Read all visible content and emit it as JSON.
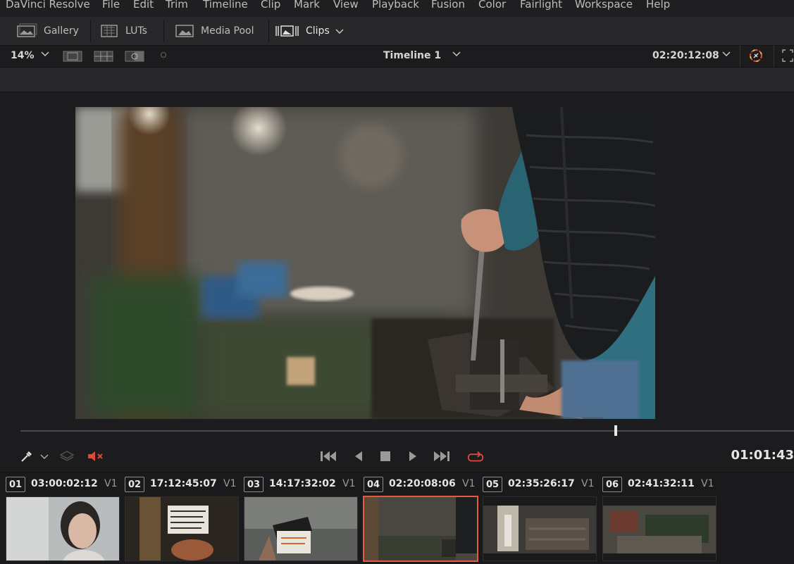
{
  "menu": {
    "app": "DaVinci Resolve",
    "items": [
      "File",
      "Edit",
      "Trim",
      "Timeline",
      "Clip",
      "Mark",
      "View",
      "Playback",
      "Fusion",
      "Color",
      "Fairlight",
      "Workspace",
      "Help"
    ]
  },
  "toolbar": {
    "gallery": "Gallery",
    "luts": "LUTs",
    "media_pool": "Media Pool",
    "clips": "Clips"
  },
  "viewer": {
    "zoom": "14%",
    "timeline_name": "Timeline 1",
    "timecode": "02:20:12:08"
  },
  "scrubber": {
    "playhead_position": 0.77
  },
  "transport": {
    "timecode": "01:01:43"
  },
  "clips": [
    {
      "num": "01",
      "tc": "03:00:02:12",
      "track": "V1"
    },
    {
      "num": "02",
      "tc": "17:12:45:07",
      "track": "V1"
    },
    {
      "num": "03",
      "tc": "14:17:32:02",
      "track": "V1"
    },
    {
      "num": "04",
      "tc": "02:20:08:06",
      "track": "V1"
    },
    {
      "num": "05",
      "tc": "02:35:26:17",
      "track": "V1"
    },
    {
      "num": "06",
      "tc": "02:41:32:11",
      "track": "V1"
    }
  ],
  "colors": {
    "accent": "#e45b3d",
    "background": "#1e1e21",
    "panel": "#28282b"
  }
}
